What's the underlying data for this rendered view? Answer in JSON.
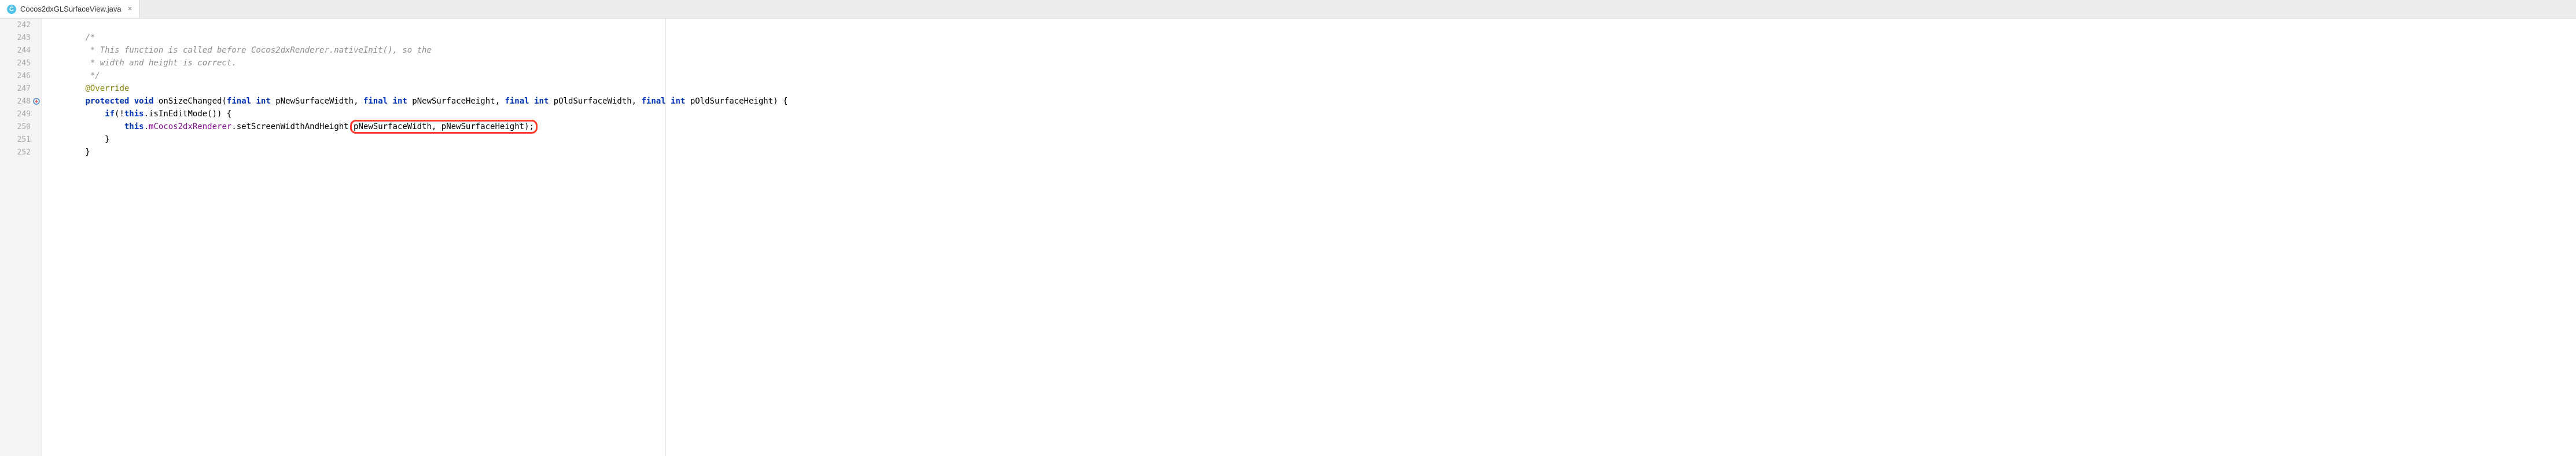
{
  "tab": {
    "icon_letter": "C",
    "filename": "Cocos2dxGLSurfaceView.java",
    "close_glyph": "×"
  },
  "lines": {
    "ln242": "242",
    "ln243": "243",
    "ln244": "244",
    "ln245": "245",
    "ln246": "246",
    "ln247": "247",
    "ln248": "248",
    "ln249": "249",
    "ln250": "250",
    "ln251": "251",
    "ln252": "252"
  },
  "code": {
    "indent243": "        ",
    "comment_open": "/*",
    "indent244": "         ",
    "comment_l1": "* This function is called before Cocos2dxRenderer.nativeInit(), so the",
    "indent245": "         ",
    "comment_l2": "* width and height is correct.",
    "indent246": "         ",
    "comment_close": "*/",
    "indent247": "        ",
    "annotation": "@Override",
    "indent248": "        ",
    "kw_protected": "protected",
    "sp1": " ",
    "kw_void": "void",
    "sp2": " ",
    "method_name": "onSizeChanged",
    "paren_open": "(",
    "kw_final1": "final",
    "sp3": " ",
    "kw_int1": "int",
    "sp4": " ",
    "param1": "pNewSurfaceWidth",
    "comma1": ", ",
    "kw_final2": "final",
    "sp5": " ",
    "kw_int2": "int",
    "sp6": " ",
    "param2": "pNewSurfaceHeight",
    "comma2": ", ",
    "kw_final3": "final",
    "sp7": " ",
    "kw_int3": "int",
    "sp8": " ",
    "param3": "pOldSurfaceWidth",
    "comma3": ", ",
    "kw_final4": "final",
    "sp9": " ",
    "kw_int4": "int",
    "sp10": " ",
    "param4": "pOldSurfaceHeight",
    "paren_close_brace": ") {",
    "indent249": "            ",
    "kw_if": "if",
    "if_open": "(!",
    "kw_this1": "this",
    "dot1": ".",
    "call_edit": "isInEditMode()) {",
    "indent250": "                ",
    "kw_this2": "this",
    "dot2": ".",
    "field_renderer": "mCocos2dxRenderer",
    "dot3": ".",
    "call_set": "setScreenWidthAndHeight(",
    "arg1": "pNewSurfaceWidth",
    "comma_args": ", ",
    "arg2": "pNewSurfaceHeight",
    "call_end": ");",
    "indent251": "            ",
    "brace_close1": "}",
    "indent252": "        ",
    "brace_close2": "}"
  }
}
